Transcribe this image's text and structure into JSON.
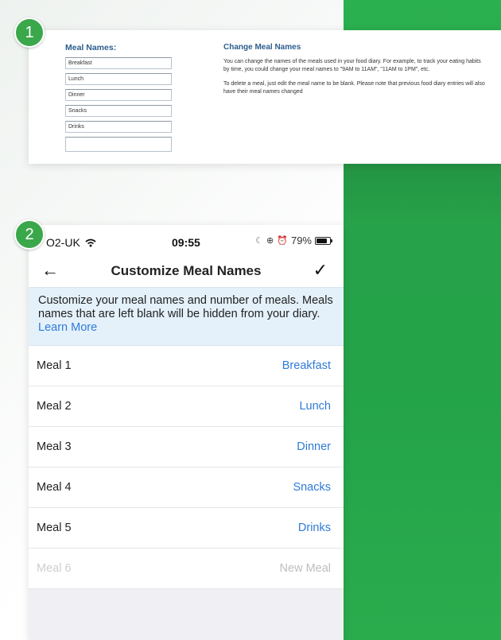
{
  "badges": {
    "first": "1",
    "second": "2"
  },
  "web_panel": {
    "heading": "Meal Names:",
    "inputs": [
      "Breakfast",
      "Lunch",
      "Dinner",
      "Snacks",
      "Drinks",
      ""
    ],
    "info_title": "Change Meal Names",
    "info_paragraph_1": "You can change the names of the meals used in your food diary. For example, to track your eating habits by time, you could change your meal names to \"9AM to 11AM\", \"11AM to 1PM\", etc.",
    "info_paragraph_2": "To delete a meal, just edit the meal name to be blank. Please note that previous food diary entries will also have their meal names changed"
  },
  "phone": {
    "status": {
      "carrier": "O2-UK",
      "time": "09:55",
      "battery": "79%"
    },
    "nav": {
      "title": "Customize Meal Names",
      "back": "←",
      "confirm": "✓"
    },
    "info_text": "Customize your meal names and number of meals. Meals names that are left blank will be hidden from your diary.",
    "info_link": "Learn More",
    "meals": [
      {
        "label": "Meal 1",
        "value": "Breakfast"
      },
      {
        "label": "Meal 2",
        "value": "Lunch"
      },
      {
        "label": "Meal 3",
        "value": "Dinner"
      },
      {
        "label": "Meal 4",
        "value": "Snacks"
      },
      {
        "label": "Meal 5",
        "value": "Drinks"
      },
      {
        "label": "Meal 6",
        "value": "New Meal"
      }
    ]
  },
  "colors": {
    "accent_green": "#2bb04f",
    "link_blue": "#2f7bd6",
    "info_bg": "#e4f1fb",
    "web_heading": "#2c5d8c"
  }
}
